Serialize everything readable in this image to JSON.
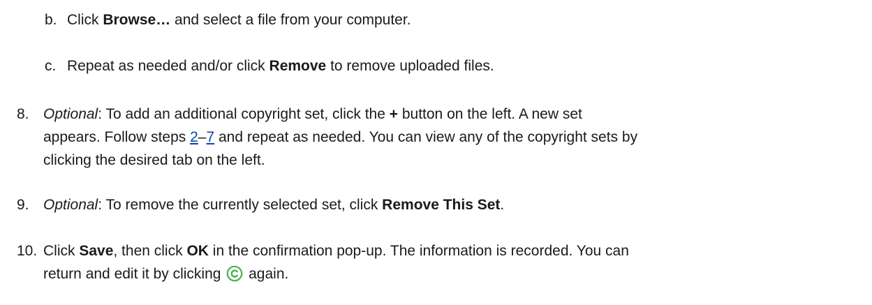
{
  "steps": {
    "sub_b": {
      "letter": "b.",
      "prefix": "Click ",
      "bold": "Browse…",
      "suffix": " and select a file from your computer."
    },
    "sub_c": {
      "letter": "c.",
      "prefix": "Repeat as needed and/or click ",
      "bold": "Remove",
      "suffix": " to remove uploaded files."
    },
    "step8": {
      "number": "8.",
      "italic": "Optional",
      "line1_a": ": To add an additional copyright set, click the ",
      "line1_bold": "+",
      "line1_b": " button on the left. A new set",
      "line2_a": "appears. Follow steps ",
      "link_start": "2",
      "dash": "–",
      "link_end": "7",
      "line2_b": " and repeat as needed. You can view any of the copyright sets by",
      "line3": "clicking the desired tab on the left."
    },
    "step9": {
      "number": "9.",
      "italic": "Optional",
      "text_a": ": To remove the currently selected set, click ",
      "bold": "Remove This Set",
      "text_b": "."
    },
    "step10": {
      "number": "10.",
      "line1_a": "Click ",
      "bold1": "Save",
      "line1_b": ", then click ",
      "bold2": "OK",
      "line1_c": " in the confirmation pop-up. The information is recorded. You can",
      "line2_a": "return and edit it by clicking ",
      "line2_b": " again."
    }
  },
  "icons": {
    "copyright": "copyright-icon"
  },
  "colors": {
    "text": "#1a1a1a",
    "link": "#0645ad",
    "icon": "#4caf50"
  }
}
